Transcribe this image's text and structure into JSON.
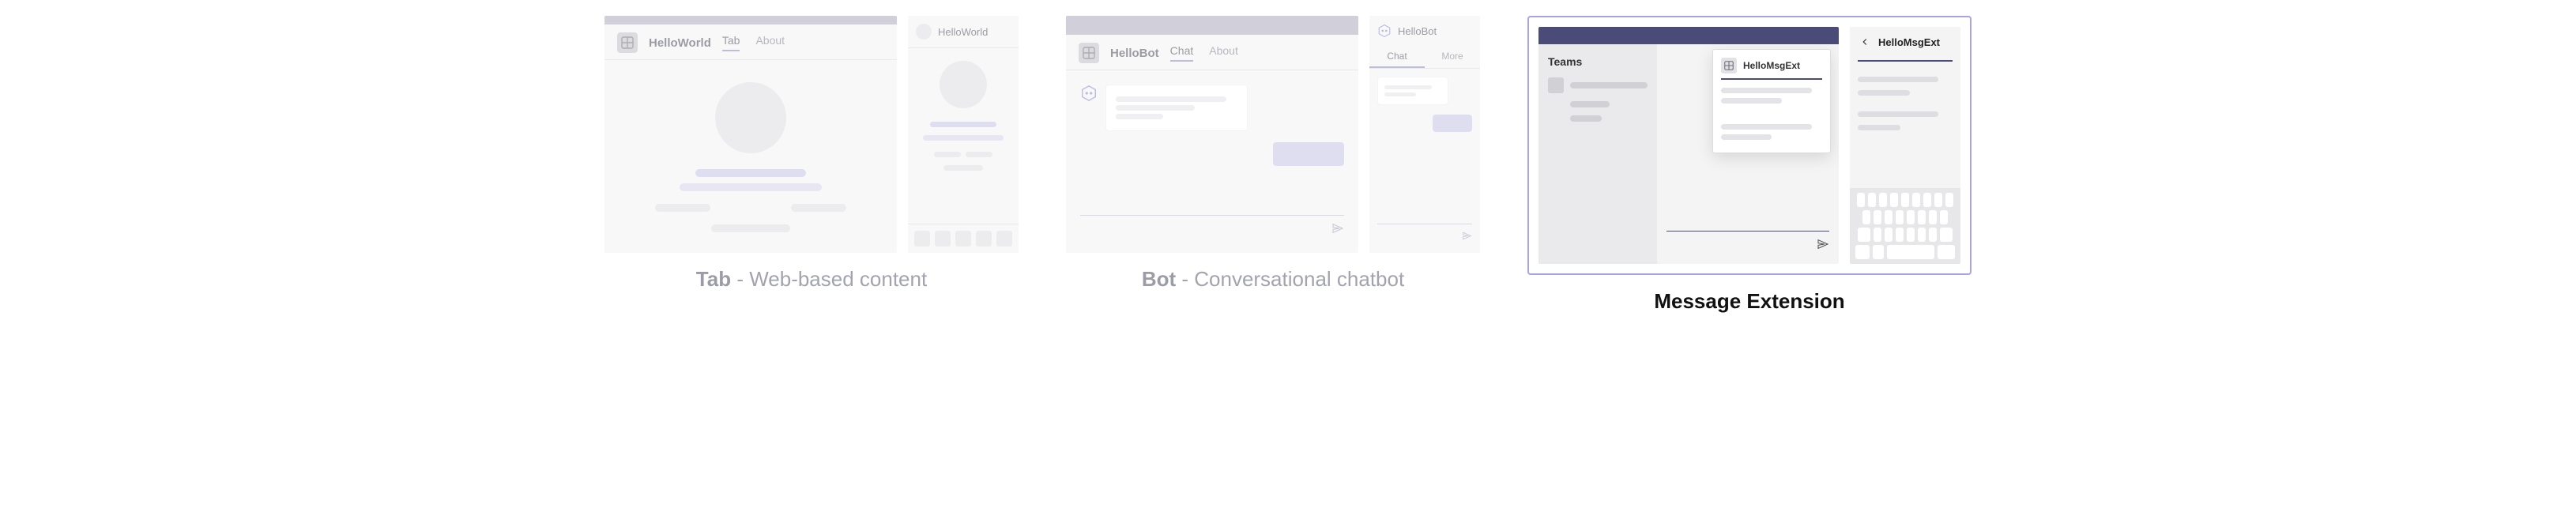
{
  "tab_panel": {
    "desktop": {
      "app_title": "HelloWorld",
      "tabs": [
        {
          "label": "Tab",
          "active": true
        },
        {
          "label": "About",
          "active": false
        }
      ]
    },
    "mobile": {
      "title": "HelloWorld"
    },
    "caption_strong": "Tab",
    "caption_rest": " - Web-based content"
  },
  "bot_panel": {
    "desktop": {
      "app_title": "HelloBot",
      "tabs": [
        {
          "label": "Chat",
          "active": true
        },
        {
          "label": "About",
          "active": false
        }
      ]
    },
    "mobile": {
      "title": "HelloBot",
      "tabs": [
        {
          "label": "Chat",
          "active": true
        },
        {
          "label": "More",
          "active": false
        }
      ]
    },
    "caption_strong": "Bot",
    "caption_rest": " - Conversational chatbot"
  },
  "mext_panel": {
    "desktop": {
      "sidebar_title": "Teams",
      "popover_title": "HelloMsgExt"
    },
    "mobile": {
      "title": "HelloMsgExt"
    },
    "caption_strong": "Message Extension",
    "caption_rest": ""
  }
}
